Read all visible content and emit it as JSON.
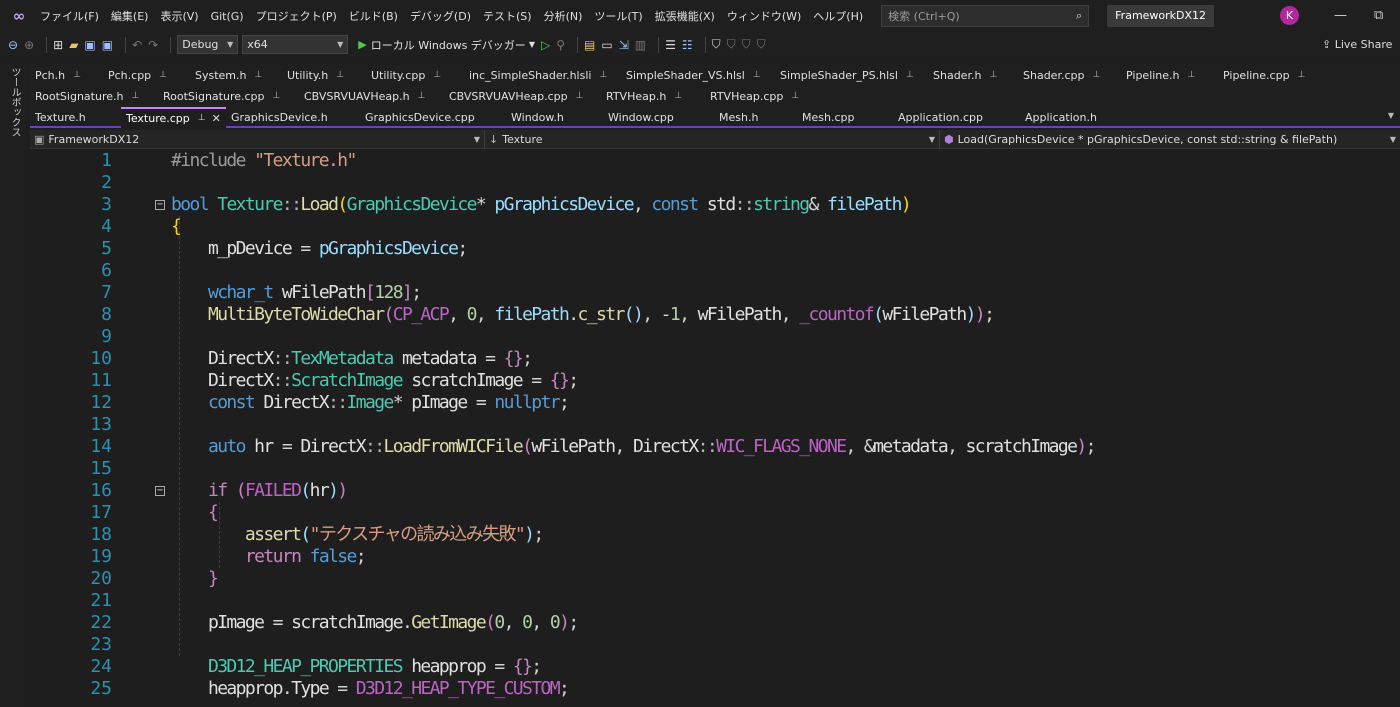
{
  "menubar": {
    "items": [
      "ファイル(F)",
      "編集(E)",
      "表示(V)",
      "Git(G)",
      "プロジェクト(P)",
      "ビルド(B)",
      "デバッグ(D)",
      "テスト(S)",
      "分析(N)",
      "ツール(T)",
      "拡張機能(X)",
      "ウィンドウ(W)",
      "ヘルプ(H)"
    ],
    "search_placeholder": "検索 (Ctrl+Q)",
    "solution_title": "FrameworkDX12",
    "avatar_initial": "K"
  },
  "toolbar": {
    "config": "Debug",
    "platform": "x64",
    "run_label": "ローカル Windows デバッガー",
    "live_share": "Live Share"
  },
  "toolbox_label": "ツールボックス",
  "tabs_row1": [
    "Pch.h",
    "Pch.cpp",
    "System.h",
    "Utility.h",
    "Utility.cpp",
    "inc_SimpleShader.hlsli",
    "SimpleShader_VS.hlsl",
    "SimpleShader_PS.hlsl",
    "Shader.h",
    "Shader.cpp",
    "Pipeline.h",
    "Pipeline.cpp"
  ],
  "tabs_row2": [
    "RootSignature.h",
    "RootSignature.cpp",
    "CBVSRVUAVHeap.h",
    "CBVSRVUAVHeap.cpp",
    "RTVHeap.h",
    "RTVHeap.cpp"
  ],
  "tabs_row3": [
    "Texture.h",
    "Texture.cpp",
    "GraphicsDevice.h",
    "GraphicsDevice.cpp",
    "Window.h",
    "Window.cpp",
    "Mesh.h",
    "Mesh.cpp",
    "Application.cpp",
    "Application.h"
  ],
  "active_tab": "Texture.cpp",
  "navbar": {
    "project": "FrameworkDX12",
    "scope": "Texture",
    "member": "Load(GraphicsDevice * pGraphicsDevice, const std::string & filePath)"
  },
  "editor": {
    "line_numbers": [
      "1",
      "2",
      "3",
      "4",
      "5",
      "6",
      "7",
      "8",
      "9",
      "10",
      "11",
      "12",
      "13",
      "14",
      "15",
      "16",
      "17",
      "18",
      "19",
      "20",
      "21",
      "22",
      "23",
      "24",
      "25"
    ]
  }
}
